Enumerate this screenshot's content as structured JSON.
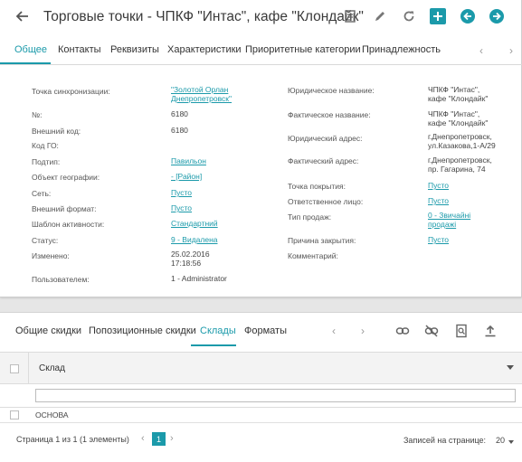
{
  "header": {
    "title": "Торговые точки - ЧПКФ \"Интас\", кафе \"Клондайк\"",
    "accent_color": "#1b9aaa",
    "icons": [
      "back-arrow-icon",
      "document-icon",
      "edit-pencil-icon",
      "refresh-icon",
      "add-icon",
      "previous-record-icon",
      "next-record-icon"
    ]
  },
  "tabs": [
    "Общее",
    "Контакты",
    "Реквизиты",
    "Характеристики",
    "Приоритетные категории",
    "Принадлежность"
  ],
  "left_fields": [
    {
      "label": "Точка синхронизации:",
      "value": "\"Золотой Орлан\nДнепропетровск\"",
      "link": true
    },
    {
      "label": "№:",
      "value": "6180",
      "link": false
    },
    {
      "label": "Внешний код:",
      "value": "6180",
      "link": false
    },
    {
      "label": "Код ГО:",
      "value": "",
      "link": false
    },
    {
      "label": "Подтип:",
      "value": "Павильон",
      "link": true
    },
    {
      "label": "Объект географии:",
      "value": "- [Район]",
      "link": true
    },
    {
      "label": "Сеть:",
      "value": "Пусто",
      "link": true
    },
    {
      "label": "Внешний формат:",
      "value": "Пусто",
      "link": true
    },
    {
      "label": "Шаблон активности:",
      "value": "Стандартний",
      "link": true
    },
    {
      "label": "Статус:",
      "value": "9 - Видалена",
      "link": true
    },
    {
      "label": "Изменено:",
      "value": "25.02.2016\n17:18:56",
      "link": false
    },
    {
      "label": "Пользователем:",
      "value": "1 - Administrator",
      "link": false
    }
  ],
  "right_fields": [
    {
      "label": "Юридическое название:",
      "value": "ЧПКФ \"Интас\",\nкафе \"Клондайк\"",
      "link": false
    },
    {
      "label": "Фактическое название:",
      "value": "ЧПКФ \"Интас\",\nкафе \"Клондайк\"",
      "link": false
    },
    {
      "label": "Юридический адрес:",
      "value": "г.Днепропетровск,\nул.Казакова,1-А/29",
      "link": false
    },
    {
      "label": "Фактический адрес:",
      "value": "г.Днепропетровск,\nпр. Гагарина, 74",
      "link": false
    },
    {
      "label": "Точка покрытия:",
      "value": "Пусто",
      "link": true
    },
    {
      "label": "Ответственное лицо:",
      "value": "Пусто",
      "link": true
    },
    {
      "label": "Тип продаж:",
      "value": "0 - Звичайні\nпродажі",
      "link": true
    },
    {
      "label": "Причина закрытия:",
      "value": "Пусто",
      "link": true
    },
    {
      "label": "Комментарий:",
      "value": "",
      "link": false
    }
  ],
  "bottom_tabs": [
    "Общие скидки",
    "Попозиционные скидки",
    "Склады",
    "Форматы"
  ],
  "grid": {
    "column": "Склад",
    "rows": [
      "ОСНОВА"
    ]
  },
  "pager": {
    "summary": "Страница 1 из 1 (1 элементы)",
    "current_page": "1",
    "page_size_label": "Записей на странице:",
    "page_size": "20"
  }
}
